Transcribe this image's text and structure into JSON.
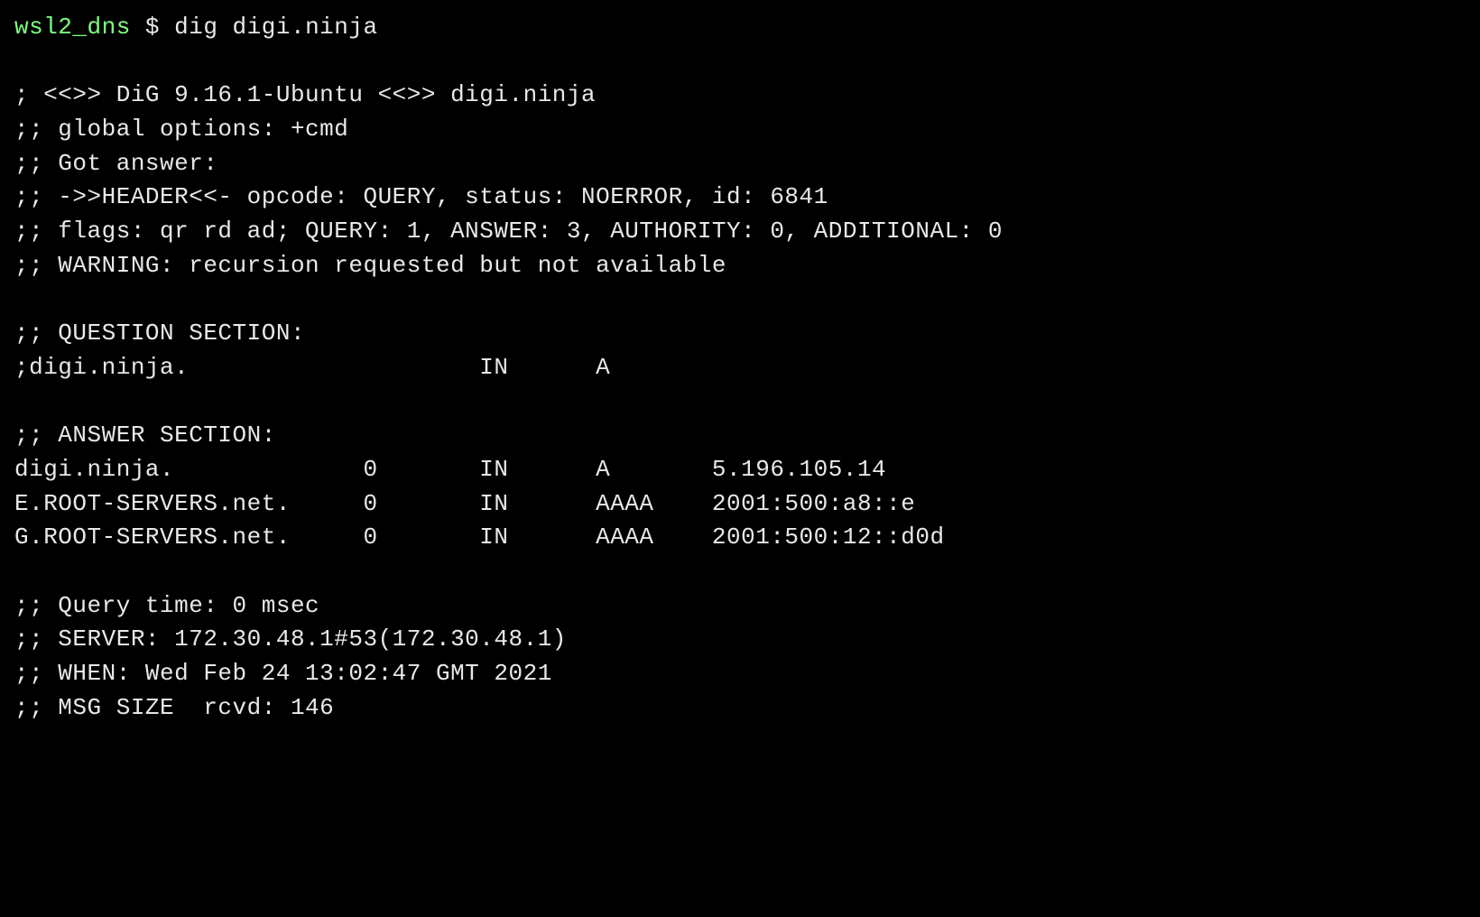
{
  "prompt": {
    "hostname": "wsl2_dns",
    "separator": " $ ",
    "command": "dig digi.ninja"
  },
  "output": {
    "banner": "; <<>> DiG 9.16.1-Ubuntu <<>> digi.ninja",
    "global_options": ";; global options: +cmd",
    "got_answer": ";; Got answer:",
    "header": ";; ->>HEADER<<- opcode: QUERY, status: NOERROR, id: 6841",
    "flags": ";; flags: qr rd ad; QUERY: 1, ANSWER: 3, AUTHORITY: 0, ADDITIONAL: 0",
    "warning": ";; WARNING: recursion requested but not available",
    "question_header": ";; QUESTION SECTION:",
    "question_line": ";digi.ninja.                    IN      A",
    "answer_header": ";; ANSWER SECTION:",
    "answer_1": "digi.ninja.             0       IN      A       5.196.105.14",
    "answer_2": "E.ROOT-SERVERS.net.     0       IN      AAAA    2001:500:a8::e",
    "answer_3": "G.ROOT-SERVERS.net.     0       IN      AAAA    2001:500:12::d0d",
    "query_time": ";; Query time: 0 msec",
    "server": ";; SERVER: 172.30.48.1#53(172.30.48.1)",
    "when": ";; WHEN: Wed Feb 24 13:02:47 GMT 2021",
    "msg_size": ";; MSG SIZE  rcvd: 146"
  }
}
